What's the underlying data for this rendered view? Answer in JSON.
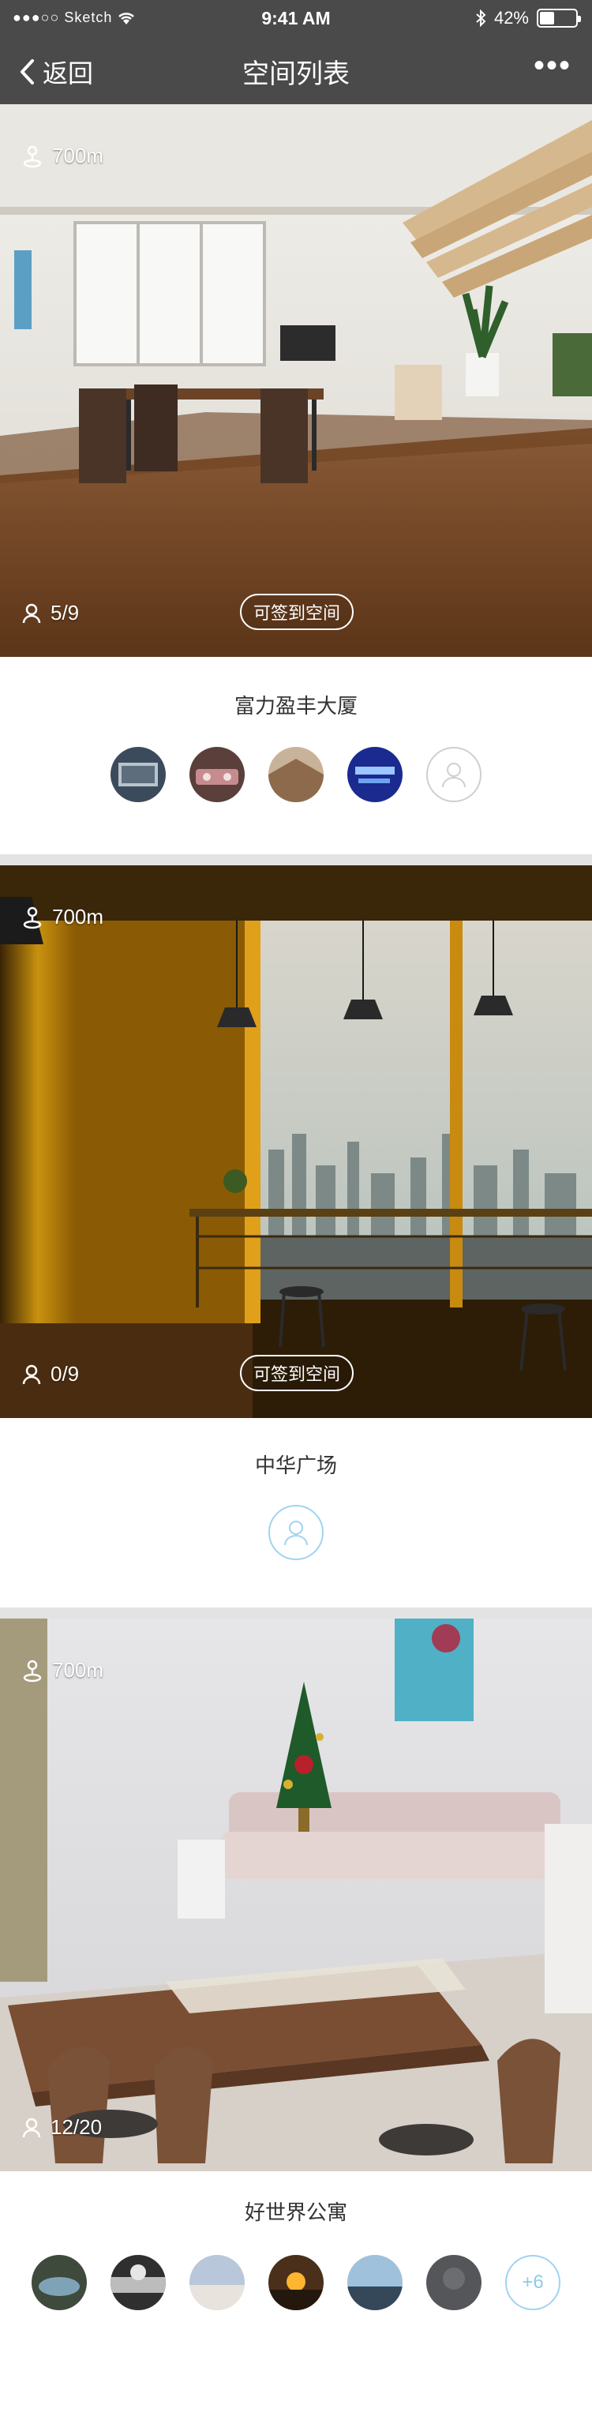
{
  "status_bar": {
    "carrier": "●●●○○ Sketch",
    "time": "9:41 AM",
    "battery": "42%",
    "battery_level": 0.42
  },
  "nav": {
    "back_label": "返回",
    "title": "空间列表",
    "more_label": "•••"
  },
  "cards": [
    {
      "distance": "700m",
      "count": "5/9",
      "button": "可签到空间",
      "name": "富力盈丰大厦"
    },
    {
      "distance": "700m",
      "count": "0/9",
      "button": "可签到空间",
      "name": "中华广场"
    },
    {
      "distance": "700m",
      "count": "12/20",
      "name": "好世界公寓",
      "more_members": "+6"
    }
  ],
  "colors": {
    "nav_bg": "#4a4a4a",
    "accent_blue": "#9fd4f0",
    "separator": "#e3e3e3"
  }
}
